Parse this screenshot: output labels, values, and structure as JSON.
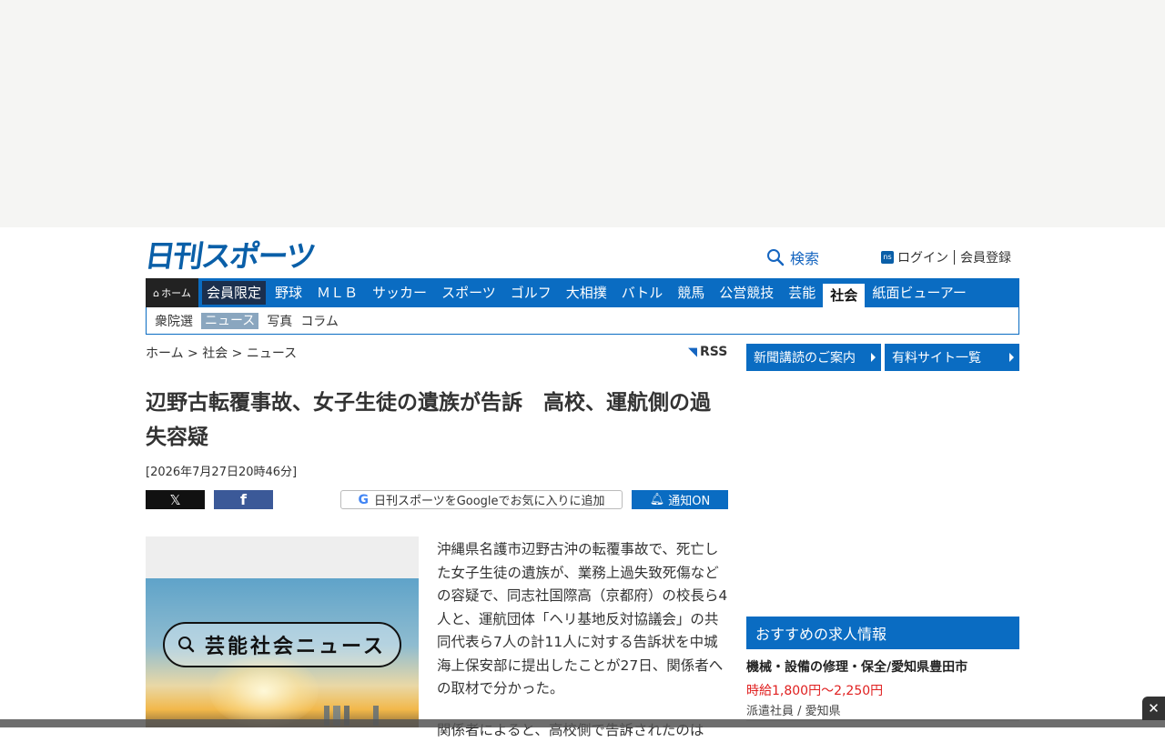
{
  "header": {
    "logo": "日刊スポーツ",
    "search_label": "検索",
    "ns_badge": "ns",
    "login": "ログイン",
    "register": "会員登録"
  },
  "gnav": {
    "home": "ホーム",
    "items": [
      "会員限定",
      "野球",
      "ＭＬＢ",
      "サッカー",
      "スポーツ",
      "ゴルフ",
      "大相撲",
      "バトル",
      "競馬",
      "公営競技",
      "芸能",
      "社会",
      "紙面ビューアー"
    ],
    "active": "社会"
  },
  "subnav": {
    "items": [
      "衆院選",
      "ニュース",
      "写真",
      "コラム"
    ],
    "active": "ニュース"
  },
  "breadcrumb": "ホーム > 社会 > ニュース",
  "rss": "RSS",
  "article": {
    "title": "辺野古転覆事故、女子生徒の遺族が告訴　高校、運航側の過失容疑",
    "date": "[2026年7月27日20時46分]",
    "photo_text": "芸能社会ニュース",
    "paragraph1": "沖縄県名護市辺野古沖の転覆事故で、死亡した女子生徒の遺族が、業務上過失致死傷などの容疑で、同志社国際高（京都府）の校長ら4人と、運航団体「ヘリ基地反対協議会」の共同代表ら7人の計11人に対する告訴状を中城海上保安部に提出したことが27日、関係者への取材で分かった。",
    "paragraph2": "関係者によると、高校側で告訴されたのは"
  },
  "share": {
    "x_label": "𝕏",
    "fb_label": "f",
    "google_label": "日刊スポーツをGoogleでお気に入りに追加",
    "notify_label": "通知ON"
  },
  "sidebar": {
    "btn1": "新聞講読のご案内",
    "btn2": "有料サイト一覧",
    "jobs_heading": "おすすめの求人情報",
    "job_title": "機械・設備の修理・保全/愛知県豊田市",
    "job_wage": "時給1,800円～2,250円",
    "job_type": "派遣社員 / 愛知県"
  },
  "close": "✕",
  "colors": {
    "brand_blue": "#0a6cc2",
    "member_navy": "#1b2f4d",
    "wage_red": "#e02020"
  }
}
